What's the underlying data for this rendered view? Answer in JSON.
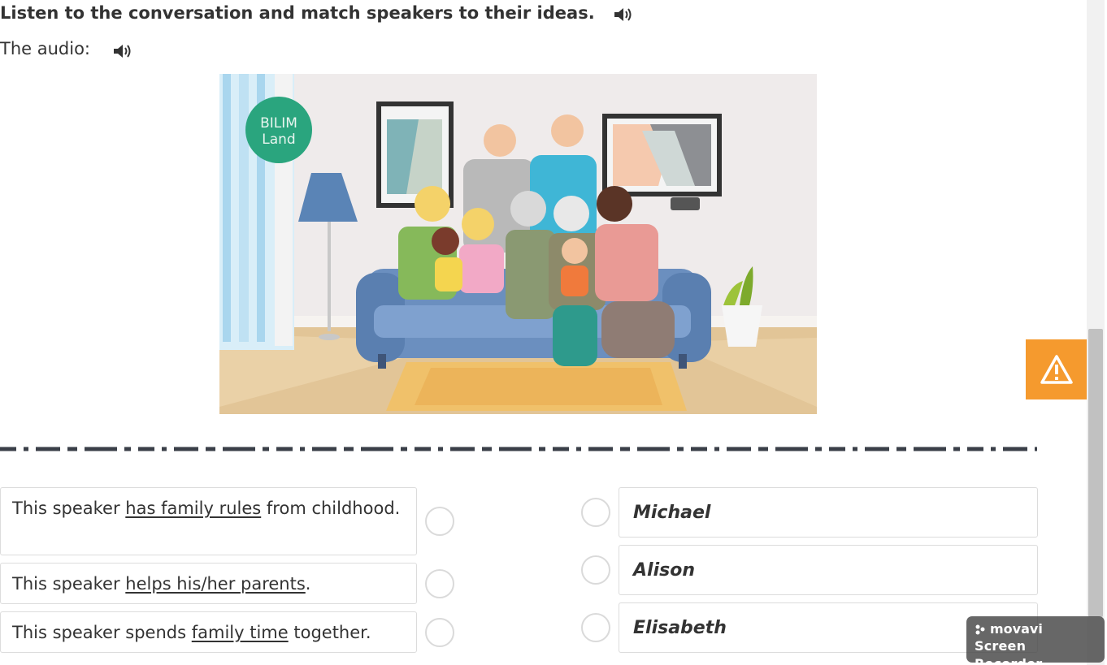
{
  "header": {
    "instruction": "Listen to the conversation and match speakers to their ideas.",
    "audio_label": "The audio:",
    "speaker_icon": "speaker-volume-icon"
  },
  "illustration": {
    "logo_text_line1": "BILIM",
    "logo_text_line2": "Land",
    "subject": "family selfie on a blue sofa in a living room"
  },
  "statements": [
    {
      "before": "This speaker ",
      "underlined": "has family rules",
      "after": " from childhood."
    },
    {
      "before": "This speaker ",
      "underlined": "helps his/her parents",
      "after": "."
    },
    {
      "before": "This speaker spends ",
      "underlined": "family time",
      "after": " together."
    }
  ],
  "names": [
    "Michael",
    "Alison",
    "Elisabeth"
  ],
  "side_button": {
    "icon": "warning-triangle-icon"
  },
  "watermark": {
    "brand": "movavi",
    "product": "Screen Recorder"
  },
  "colors": {
    "accent_orange": "#f59a2e",
    "divider": "#3a3f48",
    "logo_green": "#2aa57e",
    "sofa_blue": "#6b8fbf"
  }
}
